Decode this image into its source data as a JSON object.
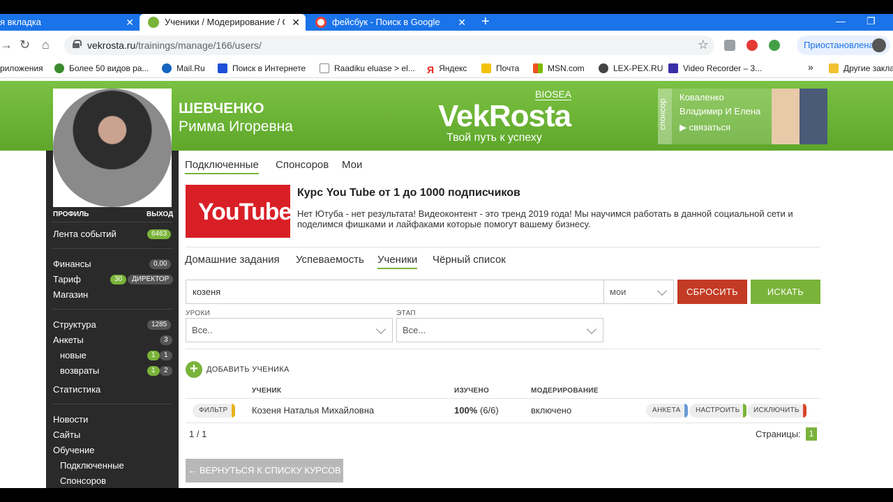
{
  "browser": {
    "tabs": [
      {
        "title": "я вкладка"
      },
      {
        "title": "Ученики / Модерирование / Ob"
      },
      {
        "title": "фейсбук - Поиск в Google"
      }
    ],
    "url_host": "vekrosta.ru",
    "url_path": "/trainings/manage/166/users/",
    "profile_status": "Приостановлена",
    "bookmarks": [
      "риложения",
      "Более 50 видов ра...",
      "Mail.Ru",
      "Поиск в Интернете",
      "Raadiku eluase > el...",
      "Яндекс",
      "Почта",
      "MSN.com",
      "LEX-PEX.RU",
      "Video Recorder – 3...",
      "Другие закла"
    ],
    "bookmarks_more": "»"
  },
  "header": {
    "user_lastname": "ШЕВЧЕНКО",
    "user_name": "Римма Игоревна",
    "logo": "VekRosta",
    "tagline": "Твой путь к успеху",
    "biosea": "BIOSEA",
    "sponsor_label": "спонсор",
    "sponsor_name_1": "Коваленко",
    "sponsor_name_2": "Владимир И Елена",
    "sponsor_contact": "▶ связаться"
  },
  "sidebar": {
    "profile": "ПРОФИЛЬ",
    "logout": "ВЫХОД",
    "feed": {
      "label": "Лента событий",
      "badge": "6463"
    },
    "finance": {
      "label": "Финансы",
      "badge": "0,00"
    },
    "tariff": {
      "label": "Тариф",
      "badge_num": "30",
      "badge_text": "ДИРЕКТОР"
    },
    "shop": "Магазин",
    "structure": {
      "label": "Структура",
      "badge": "1285"
    },
    "forms": {
      "label": "Анкеты",
      "badge": "3"
    },
    "new": {
      "label": "новые",
      "b1": "1",
      "b2": "1"
    },
    "returns": {
      "label": "возвраты",
      "b1": "1",
      "b2": "2"
    },
    "stats": "Статистика",
    "news": "Новости",
    "sites": "Сайты",
    "training": "Обучение",
    "connected": "Подключенные",
    "sponsors": "Спонсоров"
  },
  "main": {
    "top_tabs": [
      "Подключенные",
      "Спонсоров",
      "Мои"
    ],
    "course_logo": "YouTube",
    "course_title": "Курс You Tube от 1 до 1000 подписчиков",
    "course_desc_1": "Нет Ютуба - нет результата! Видеоконтент - это тренд 2019 года! Мы научимся работать в данной социальной сети и",
    "course_desc_2": "поделимся фишками и лайфаками которые помогут вашему бизнесу.",
    "sub_tabs": [
      "Домашние задания",
      "Успеваемость",
      "Ученики",
      "Чёрный список"
    ],
    "search_value": "козеня",
    "scope_value": "мои",
    "reset_button": "СБРОСИТЬ",
    "search_button": "ИСКАТЬ",
    "lessons_label": "УРОКИ",
    "lessons_value": "Все..",
    "stage_label": "ЭТАП",
    "stage_value": "Все...",
    "add_student": "ДОБАВИТЬ УЧЕНИКА",
    "table": {
      "headers": [
        "УЧЕНИК",
        "ИЗУЧЕНО",
        "МОДЕРИРОВАНИЕ"
      ],
      "row": {
        "filter": "ФИЛЬТР",
        "student": "Козеня Наталья Михайловна",
        "learned_pct": "100%",
        "learned_count": "(6/6)",
        "moderation": "включено",
        "actions": [
          "АНКЕТА",
          "НАСТРОИТЬ",
          "ИСКЛЮЧИТЬ"
        ]
      }
    },
    "pagination_left": "1 / 1",
    "pages_label": "Страницы:",
    "page_current": "1",
    "back_button": "← ВЕРНУТЬСЯ К СПИСКУ КУРСОВ"
  },
  "colors": {
    "green": "#7ab33a",
    "red": "#c33b24",
    "chrome_blue": "#1a73e8"
  }
}
